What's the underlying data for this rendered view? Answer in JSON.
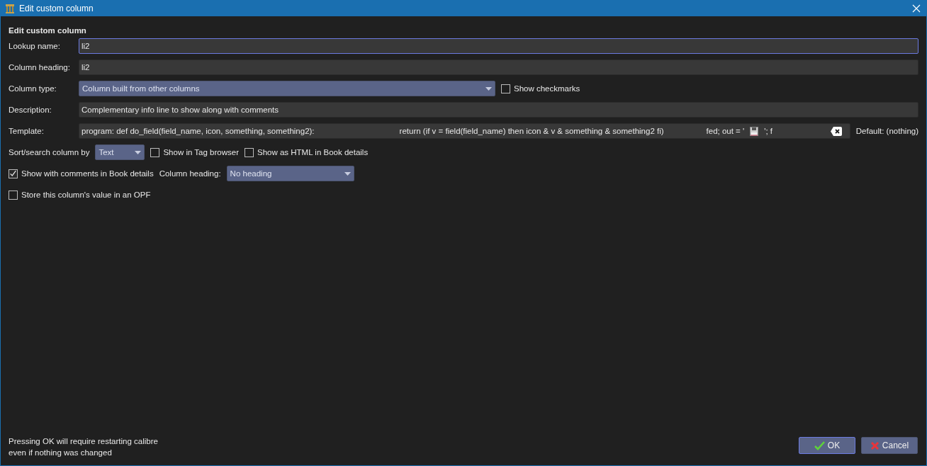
{
  "window": {
    "title": "Edit custom column"
  },
  "heading": "Edit custom column",
  "lookup_name": {
    "label": "Lookup name:",
    "value": "li2",
    "focused": true
  },
  "column_heading": {
    "label": "Column heading:",
    "value": "li2"
  },
  "column_type": {
    "label": "Column type:",
    "value": "Column built from other columns",
    "show_checkmarks": {
      "label": "Show checkmarks",
      "checked": false
    }
  },
  "description": {
    "label": "Description:",
    "value": "Complementary info line to show along with comments"
  },
  "template": {
    "label": "Template:",
    "parts": [
      {
        "kind": "text",
        "text": "program: def do_field(field_name, icon, something, something2):"
      },
      {
        "kind": "text",
        "text": "return (if v = field(field_name) then icon & v  & something & something2 fi)"
      },
      {
        "kind": "text",
        "text": "fed; out = '"
      },
      {
        "kind": "icon"
      },
      {
        "kind": "text",
        "text": "'; f"
      }
    ],
    "default": "Default: (nothing)"
  },
  "sort_search": {
    "label": "Sort/search column by",
    "value": "Text"
  },
  "options_row": [
    {
      "label": "Show in Tag browser",
      "checked": false
    },
    {
      "label": "Show as HTML in Book details",
      "checked": false
    }
  ],
  "show_with_comments": {
    "label": "Show with comments in Book details",
    "checked": true,
    "heading_label": "Column heading:",
    "heading_value": "No heading"
  },
  "store_in_opf": {
    "label": "Store this column's value in an OPF",
    "checked": false
  },
  "footer_note": [
    "Pressing OK will require restarting calibre",
    "even if nothing was changed"
  ],
  "buttons": [
    {
      "kind": "ok",
      "label": "OK",
      "default": true
    },
    {
      "kind": "cancel",
      "label": "Cancel",
      "default": false
    }
  ]
}
